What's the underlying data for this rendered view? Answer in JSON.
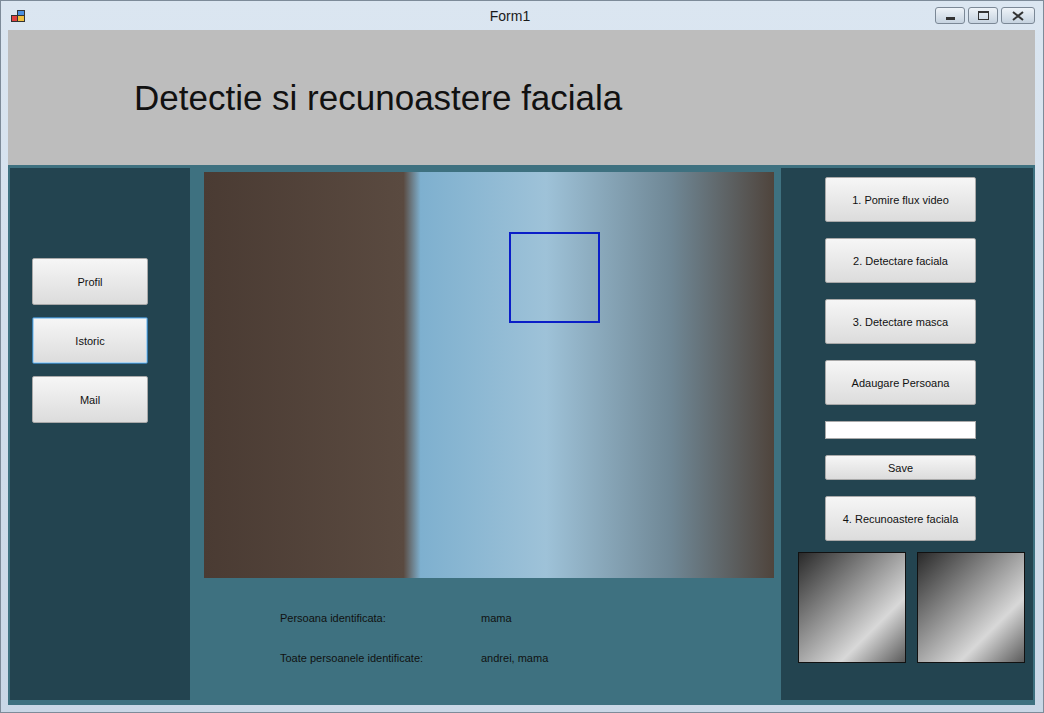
{
  "window": {
    "title": "Form1"
  },
  "header": {
    "title": "Detectie si recunoastere faciala"
  },
  "sidebar": {
    "items": [
      {
        "label": "Profil",
        "focused": false
      },
      {
        "label": "Istoric",
        "focused": true
      },
      {
        "label": "Mail",
        "focused": false
      }
    ]
  },
  "video": {
    "face_box": true
  },
  "results": [
    {
      "label": "Persoana identificata:",
      "value": "mama"
    },
    {
      "label": "Toate persoanele identificate:",
      "value": "andrei, mama"
    }
  ],
  "actions": [
    {
      "kind": "button",
      "label": "1. Pomire flux video"
    },
    {
      "kind": "button",
      "label": "2. Detectare faciala"
    },
    {
      "kind": "button",
      "label": "3. Detectare masca"
    },
    {
      "kind": "button",
      "label": "Adaugare Persoana"
    },
    {
      "kind": "field",
      "label": ""
    },
    {
      "kind": "small-button",
      "label": "Save"
    },
    {
      "kind": "button",
      "label": "4. Recunoastere faciala"
    }
  ]
}
